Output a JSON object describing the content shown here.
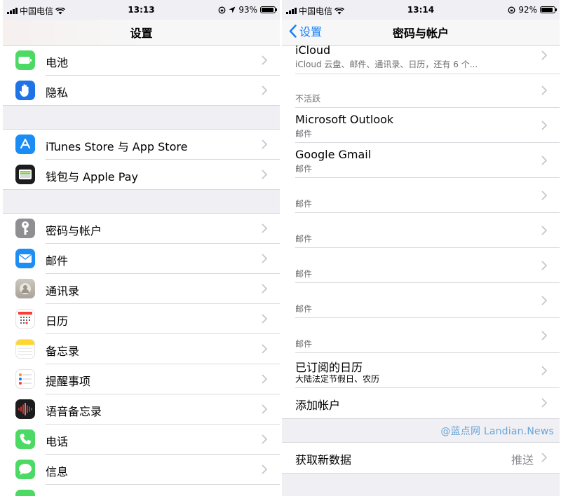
{
  "left": {
    "status": {
      "carrier": "中国电信",
      "time": "13:13",
      "battery": "93%",
      "battery_level": 0.93
    },
    "nav": {
      "title": "设置"
    },
    "rows": [
      {
        "label": "电池",
        "icon": "battery-icon",
        "color": "#4cd964"
      },
      {
        "label": "隐私",
        "icon": "hand-icon",
        "color": "#1e74e6"
      },
      {
        "label": "iTunes Store 与 App Store",
        "icon": "app-store-icon",
        "color": "#1a8cf6"
      },
      {
        "label": "钱包与 Apple Pay",
        "icon": "wallet-icon",
        "color": "#1c1c1e"
      },
      {
        "label": "密码与帐户",
        "icon": "key-icon",
        "color": "#8e8e93"
      },
      {
        "label": "邮件",
        "icon": "mail-icon",
        "color": "#1d8ef5"
      },
      {
        "label": "通讯录",
        "icon": "contacts-icon",
        "color": "#b8b2a8"
      },
      {
        "label": "日历",
        "icon": "calendar-icon",
        "color": "#ffffff"
      },
      {
        "label": "备忘录",
        "icon": "notes-icon",
        "color": "#ffffff"
      },
      {
        "label": "提醒事项",
        "icon": "reminders-icon",
        "color": "#ffffff"
      },
      {
        "label": "语音备忘录",
        "icon": "voice-memos-icon",
        "color": "#1c1c1e"
      },
      {
        "label": "电话",
        "icon": "phone-icon",
        "color": "#4cd964"
      },
      {
        "label": "信息",
        "icon": "messages-icon",
        "color": "#4cd964"
      }
    ]
  },
  "right": {
    "status": {
      "carrier": "中国电信",
      "time": "13:14",
      "battery": "92%",
      "battery_level": 0.92
    },
    "nav": {
      "title": "密码与帐户",
      "back": "设置"
    },
    "icloud": {
      "title": "iCloud",
      "subtitle": "iCloud 云盘、邮件、通讯录、日历，还有 6 个..."
    },
    "inactive_header": "不活跃",
    "accounts": [
      {
        "title": "Microsoft Outlook",
        "subtitle": "邮件"
      },
      {
        "title": "Google Gmail",
        "subtitle": "邮件"
      },
      {
        "title": "",
        "subtitle": "邮件"
      },
      {
        "title": "",
        "subtitle": "邮件"
      },
      {
        "title": "",
        "subtitle": "邮件"
      },
      {
        "title": "",
        "subtitle": "邮件"
      },
      {
        "title": "",
        "subtitle": "邮件"
      }
    ],
    "subscribed": {
      "title": "已订阅的日历",
      "subtitle": "大陆法定节假日、农历"
    },
    "add_account": "添加帐户",
    "fetch": {
      "label": "获取新数据",
      "value": "推送"
    },
    "watermark": "@蓝点网 Landian.News"
  },
  "colors": {
    "ios_blue": "#147efb",
    "group_bg": "#efeff4",
    "chevron": "#c7c7cc"
  }
}
